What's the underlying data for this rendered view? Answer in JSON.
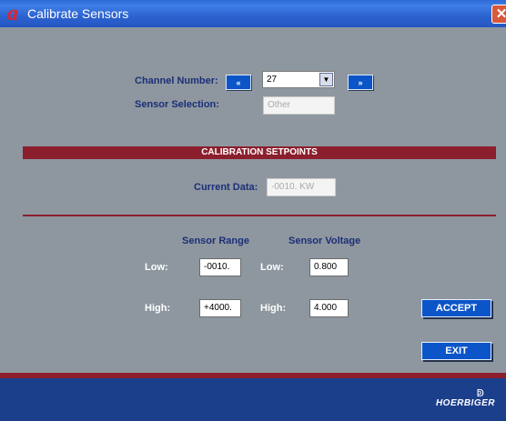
{
  "window": {
    "title": "Calibrate Sensors",
    "close_glyph": "✕",
    "logo_glyph": "a"
  },
  "channel": {
    "label": "Channel Number:",
    "prev_label": "«",
    "next_label": "»",
    "value": "27",
    "dropdown_glyph": "▼"
  },
  "sensor_selection": {
    "label": "Sensor Selection:",
    "value": "Other"
  },
  "calibration": {
    "heading": "CALIBRATION SETPOINTS",
    "current_data_label": "Current Data:",
    "current_data_value": "-0010. KW"
  },
  "table": {
    "range_header": "Sensor Range",
    "voltage_header": "Sensor Voltage",
    "low_label": "Low:",
    "high_label": "High:",
    "range_low": "-0010.",
    "range_high": "+4000.",
    "voltage_low": "0.800",
    "voltage_high": "4.000"
  },
  "buttons": {
    "accept": "ACCEPT",
    "exit": "EXIT"
  },
  "footer": {
    "brand": "HOERBIGER",
    "brand_mark": "ↁ"
  },
  "colors": {
    "accent_red": "#8b1f2e",
    "button_blue": "#0b55c8",
    "footer_blue": "#1c3f8c",
    "background": "#8e979f"
  }
}
